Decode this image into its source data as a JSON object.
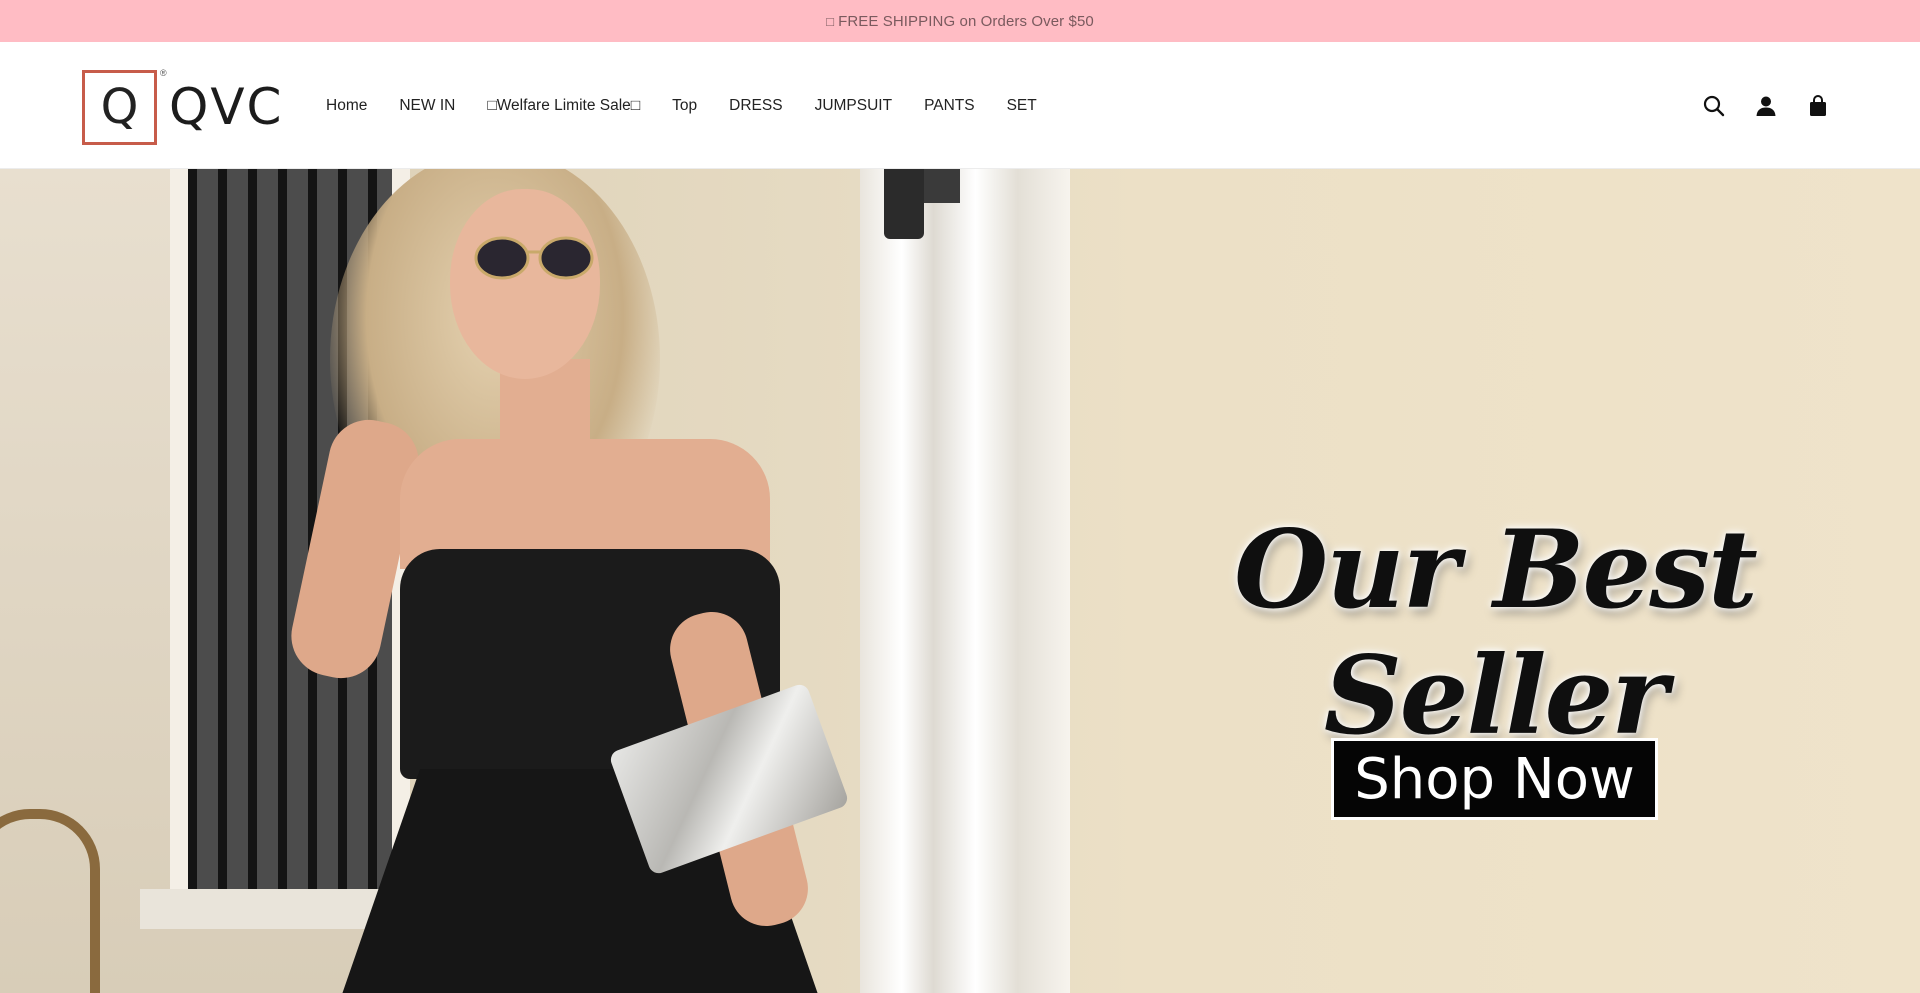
{
  "announcement": {
    "glyph": "□",
    "text": "FREE SHIPPING on Orders Over $50"
  },
  "header": {
    "logo": {
      "mark": "Q",
      "text": "QVC",
      "registered": "®",
      "border_color": "#c75c4a"
    },
    "nav": [
      {
        "label": "Home"
      },
      {
        "label": "NEW IN"
      },
      {
        "label": "□Welfare Limite Sale□"
      },
      {
        "label": "Top"
      },
      {
        "label": "DRESS"
      },
      {
        "label": "JUMPSUIT"
      },
      {
        "label": "PANTS"
      },
      {
        "label": "SET"
      }
    ],
    "icons": [
      "search-icon",
      "account-icon",
      "cart-bag-icon"
    ]
  },
  "hero": {
    "headline": "Our Best Seller",
    "cta": "Shop Now"
  },
  "colors": {
    "announcement_bg": "#ffbcc4",
    "logo_accent": "#c75c4a",
    "cta_bg": "#050505"
  }
}
